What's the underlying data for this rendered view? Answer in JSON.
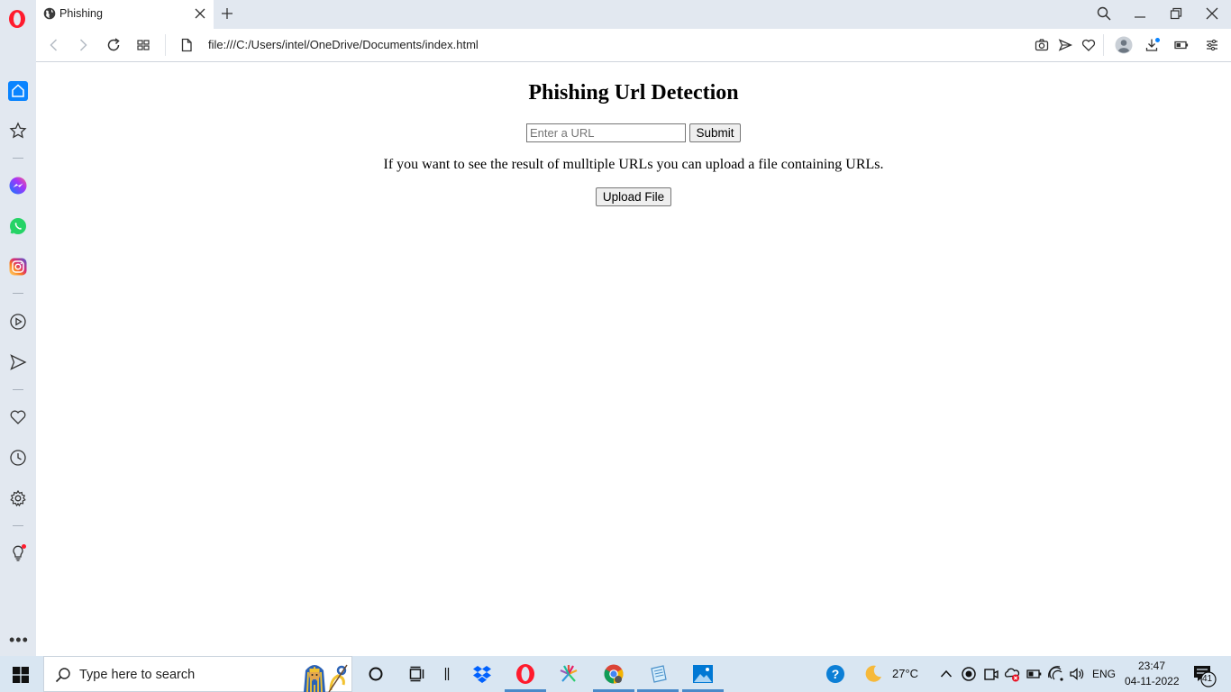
{
  "browser": {
    "tab_title": "Phishing",
    "url": "file:///C:/Users/intel/OneDrive/Documents/index.html"
  },
  "page": {
    "title": "Phishing Url Detection",
    "url_placeholder": "Enter a URL",
    "submit_label": "Submit",
    "info_text": "If you want to see the result of mulltiple URLs you can upload a file containing URLs.",
    "upload_label": "Upload File"
  },
  "taskbar": {
    "search_placeholder": "Type here to search",
    "weather": "27°C",
    "language": "ENG",
    "time": "23:47",
    "date": "04-11-2022",
    "notification_count": "41"
  },
  "colors": {
    "opera_red": "#ff1b2d",
    "chrome_bg": "#e2e8f0",
    "taskbar_bg": "#d9e6f2",
    "accent_blue": "#0a84ff"
  }
}
